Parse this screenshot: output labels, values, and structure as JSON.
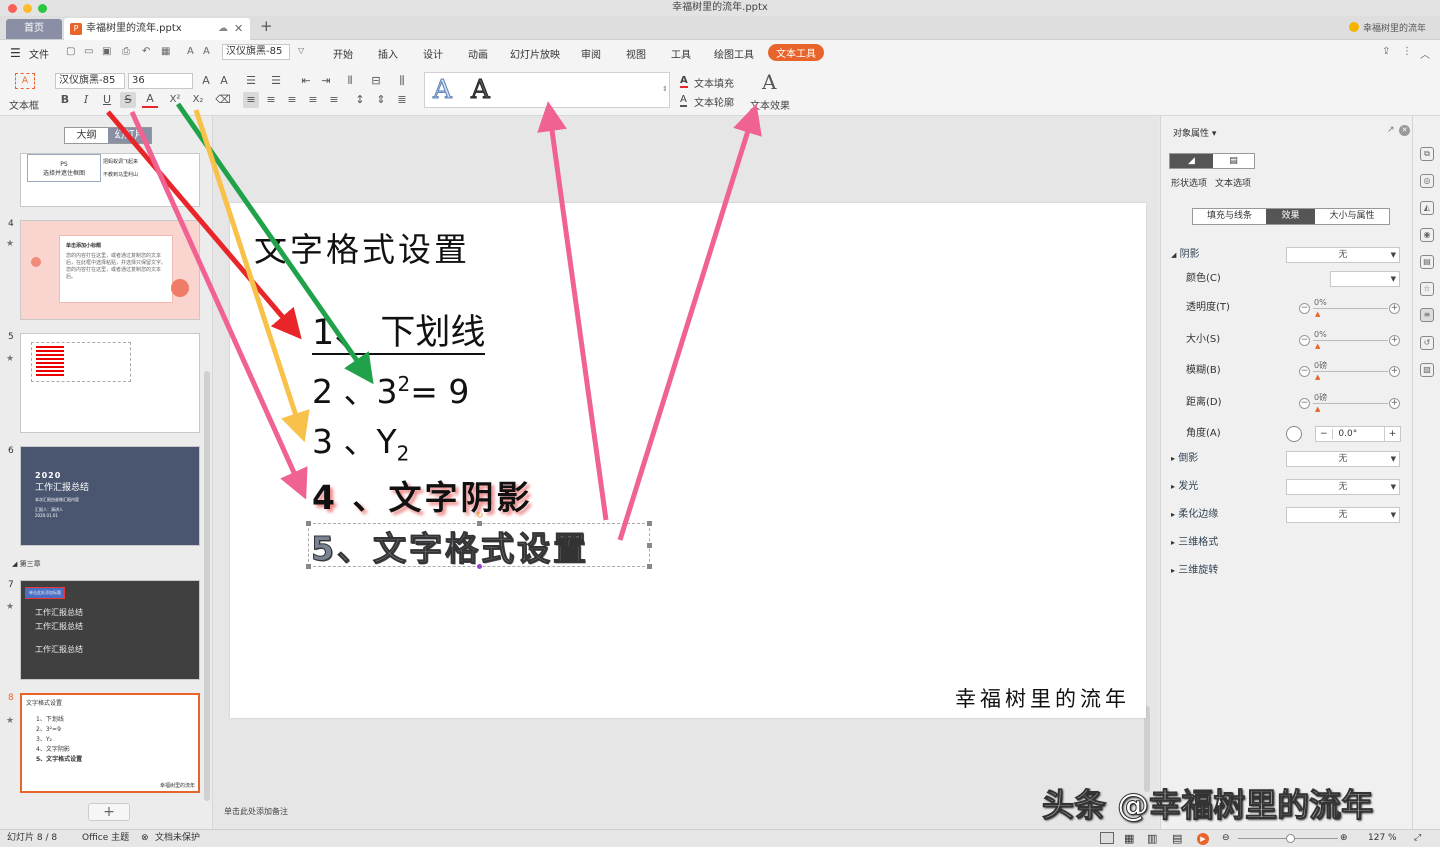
{
  "window": {
    "title": "幸福树里的流年.pptx"
  },
  "tabs": {
    "home": "首页",
    "doc": "幸福树里的流年.pptx",
    "user": "幸福树里的流年"
  },
  "menu": {
    "file": "文件",
    "items": [
      "开始",
      "插入",
      "设计",
      "动画",
      "幻灯片放映",
      "审阅",
      "视图",
      "工具",
      "绘图工具"
    ],
    "active": "文本工具"
  },
  "ribbon": {
    "textbox": "文本框",
    "font": "汉仪旗黑-85",
    "font_menu": "汉仪旗黑-85",
    "size": "36",
    "fill": "文本填充",
    "outline": "文本轮廓",
    "effect": "文本效果"
  },
  "leftpane": {
    "tab_outline": "大纲",
    "tab_slides": "幻灯片",
    "section": "第三章",
    "t3": {
      "a": "PS",
      "b": "选择并遮住框图",
      "c": "把蚂蚁调飞起来",
      "d": "不教到马里利山"
    },
    "t4": {
      "title": "单击添加小标题",
      "body": "您的内容打在这里，或者通过复制您的文本后，在此框中选择粘贴，并选择只保留文字。您的内容打在这里，或者通过复制您的文本后。"
    },
    "t6": {
      "year": "2020",
      "title": "工作汇报总结",
      "sub": "本次汇报由谁做汇报内容",
      "line1": "汇报人：演讲人",
      "line2": "2020.01.01"
    },
    "t7": {
      "tag": "单击此处添加标题",
      "a": "工作汇报总结",
      "b": "工作汇报总结",
      "c": "工作汇报总结"
    },
    "t8": {
      "title": "文字格式设置",
      "items": [
        "1、下划线",
        "2、3²=9",
        "3、Y₂",
        "4、文字阴影",
        "5、文字格式设置"
      ],
      "footer": "幸福树里的流年"
    },
    "add": "+"
  },
  "slide": {
    "title": "文字格式设置",
    "l1a": "1",
    "l1b": "、 下划线",
    "l2a": "2 、3",
    "l2sup": "2",
    "l2b": "= 9",
    "l3a": "3 、Y",
    "l3sub": "2",
    "l4": "4 、文字阴影",
    "l5": "5、文字格式设置",
    "footer": "幸福树里的流年"
  },
  "notes": "单击此处添加备注",
  "rightpane": {
    "title": "对象属性",
    "tab_shape": "形状选项",
    "tab_text": "文本选项",
    "sub_fill": "填充与线条",
    "sub_effect": "效果",
    "sub_size": "大小与属性",
    "shadow": "阴影",
    "shadow_val": "无",
    "color": "颜色(C)",
    "transparency": "透明度(T)",
    "t_val": "0%",
    "size": "大小(S)",
    "s_val": "0%",
    "blur": "模糊(B)",
    "b_val": "0磅",
    "distance": "距离(D)",
    "d_val": "0磅",
    "angle": "角度(A)",
    "a_val": "0.0°",
    "reflection": "倒影",
    "reflection_val": "无",
    "glow": "发光",
    "glow_val": "无",
    "soft": "柔化边缘",
    "soft_val": "无",
    "3d_format": "三维格式",
    "3d_rotate": "三维旋转"
  },
  "status": {
    "slide": "幻灯片 8 / 8",
    "theme": "Office 主题",
    "protect": "文档未保护",
    "zoom": "127 %"
  },
  "watermark": "头条 @幸福树里的流年",
  "colors": {
    "accent": "#e8642b",
    "red_arrow": "#e8262a",
    "green_arrow": "#21a24a",
    "yellow_arrow": "#f8c24a",
    "pink_arrow": "#f06292"
  }
}
